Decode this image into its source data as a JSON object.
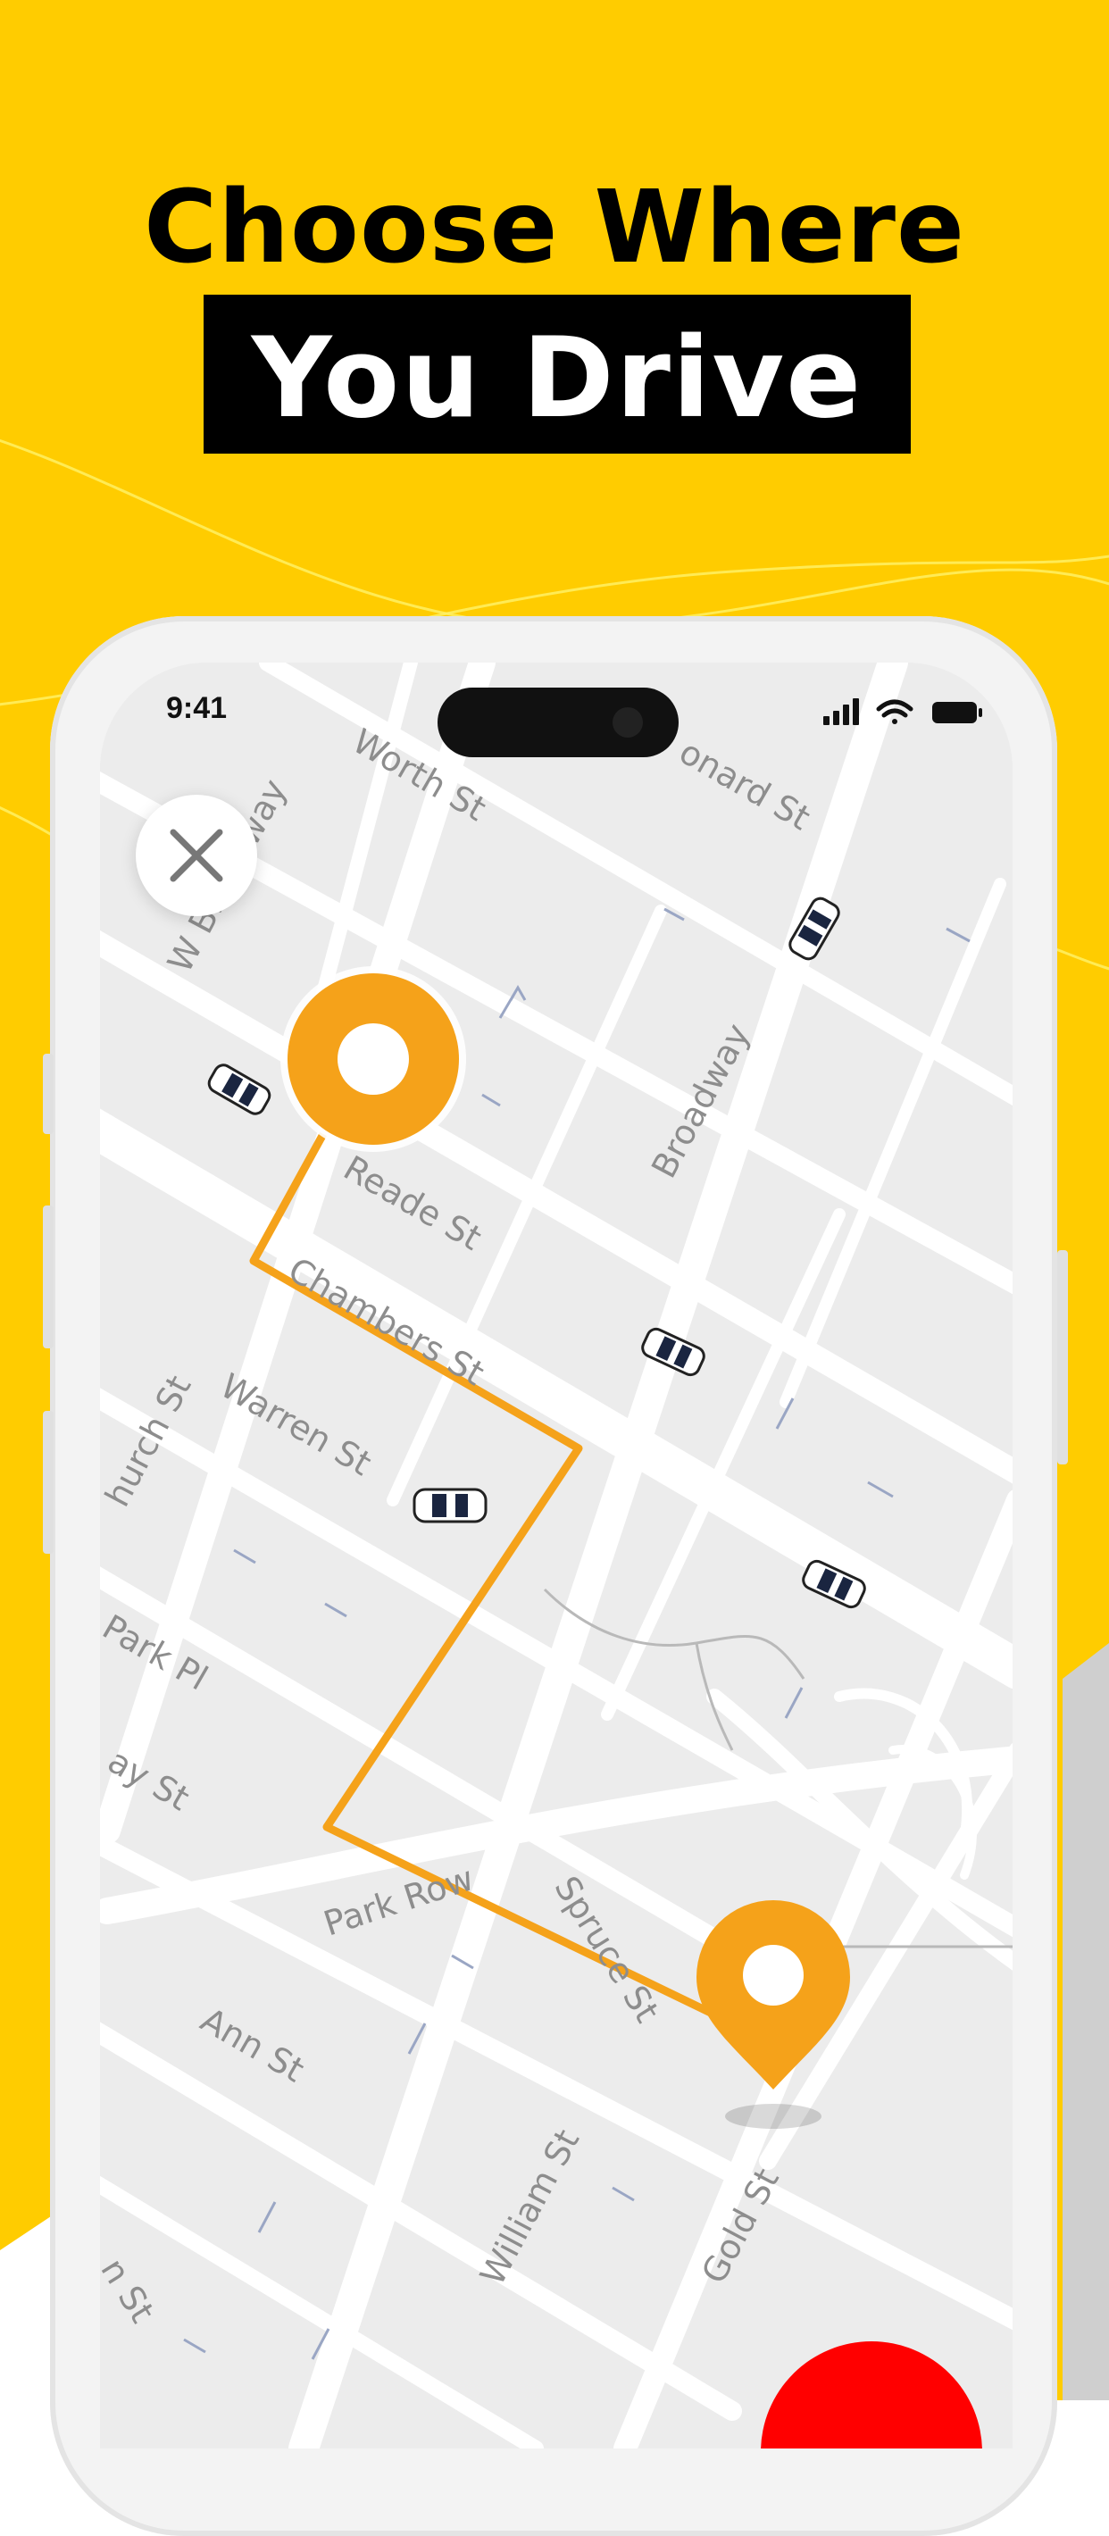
{
  "headline": {
    "line1": "Choose Where",
    "line2": "You Drive"
  },
  "colors": {
    "background": "#FFCC00",
    "route": "#F5A21A",
    "pin": "#F5A21A",
    "map_background": "#ECECEC",
    "road": "#FFFFFF",
    "headline_box": "#000000",
    "action_button": "#FF0000"
  },
  "status_bar": {
    "time": "9:41",
    "icons": [
      "signal-icon",
      "wifi-icon",
      "battery-icon"
    ]
  },
  "map": {
    "close_icon": "close-icon",
    "street_labels": {
      "worth": "Worth St",
      "leonard": "onard St",
      "w_broadway": "W Broadway",
      "broadway": "Broadway",
      "reade": "Reade St",
      "chambers": "Chambers St",
      "warren": "Warren St",
      "church": "hurch St",
      "park_pl": "Park Pl",
      "murray": "ay St",
      "park_row": "Park Row",
      "spruce": "Spruce St",
      "ann": "Ann St",
      "william": "William St",
      "gold": "Gold St",
      "fulton": "n St"
    },
    "markers": {
      "origin": "origin-pin-icon",
      "destination": "destination-pin-icon",
      "cars": "taxi-car-icon"
    }
  }
}
